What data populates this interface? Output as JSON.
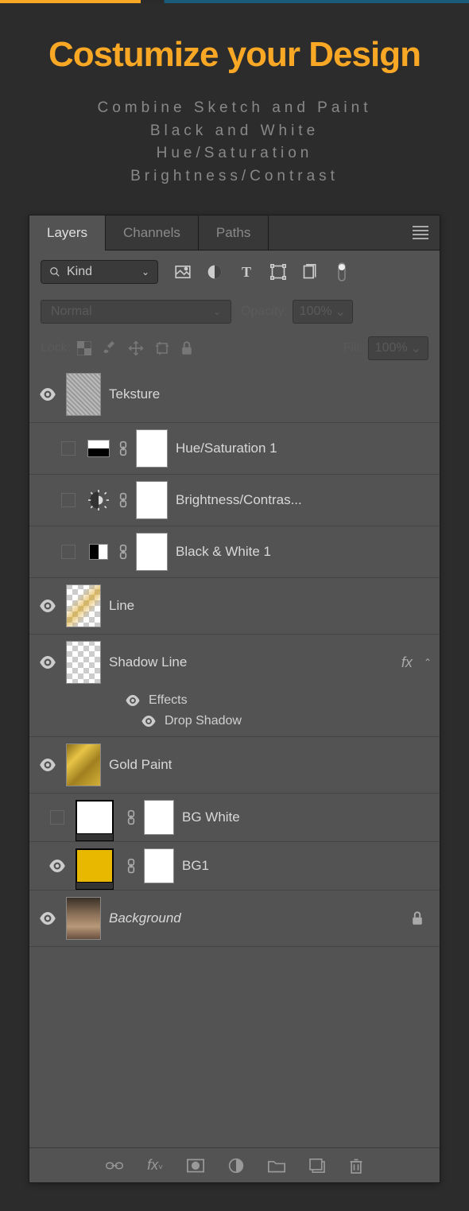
{
  "headline": "Costumize your Design",
  "subhead_lines": [
    "Combine Sketch and Paint",
    "Black and White",
    "Hue/Saturation",
    "Brightness/Contrast"
  ],
  "tabs": {
    "layers": "Layers",
    "channels": "Channels",
    "paths": "Paths"
  },
  "filter": {
    "kind": "Kind"
  },
  "blend": {
    "mode": "Normal",
    "opacity_label": "Opacity:",
    "opacity_value": "100%"
  },
  "lock": {
    "label": "Lock:",
    "fill_label": "Fill:",
    "fill_value": "100%"
  },
  "layers": {
    "teksture": "Teksture",
    "hue": "Hue/Saturation 1",
    "bright": "Brightness/Contras...",
    "bw": "Black & White 1",
    "line": "Line",
    "shadow": "Shadow Line",
    "fx": "fx",
    "effects": "Effects",
    "drop": "Drop Shadow",
    "goldpaint": "Gold Paint",
    "bgwhite": "BG White",
    "bg1": "BG1",
    "background": "Background"
  }
}
